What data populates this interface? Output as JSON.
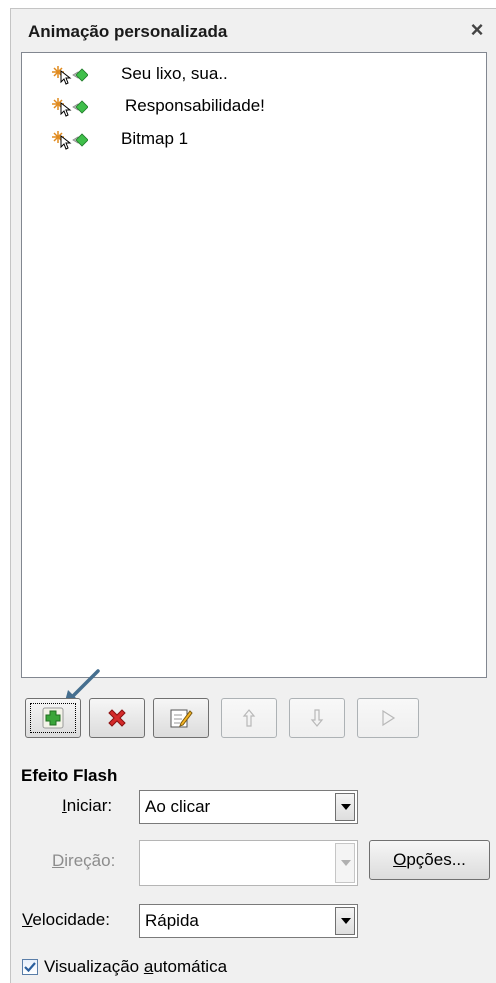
{
  "panel": {
    "title": "Animação personalizada",
    "close_glyph": "×"
  },
  "animation_list": [
    {
      "label": "Seu lixo, sua..",
      "icon": "flash-effect-icon"
    },
    {
      "label": "Responsabilidade!",
      "icon": "flash-effect-icon"
    },
    {
      "label": "Bitmap 1",
      "icon": "flash-effect-icon"
    }
  ],
  "toolbar": {
    "buttons": [
      {
        "name": "add-effect-button",
        "icon": "plus-icon",
        "enabled": true,
        "focused": true
      },
      {
        "name": "remove-effect-button",
        "icon": "delete-x-icon",
        "enabled": true
      },
      {
        "name": "edit-effect-button",
        "icon": "edit-pencil-icon",
        "enabled": true
      },
      {
        "name": "move-up-button",
        "icon": "arrow-up-icon",
        "enabled": false
      },
      {
        "name": "move-down-button",
        "icon": "arrow-down-icon",
        "enabled": false
      },
      {
        "name": "play-button",
        "icon": "play-icon",
        "enabled": false
      }
    ],
    "pointer_annotation": "arrow-pointer-icon"
  },
  "effect": {
    "heading": "Efeito Flash",
    "start": {
      "label_prefix": "",
      "label_mnemonic": "I",
      "label_rest": "niciar:",
      "value": "Ao clicar"
    },
    "direction": {
      "label_prefix": "",
      "label_mnemonic": "D",
      "label_rest": "ireção:",
      "value": ""
    },
    "speed": {
      "label_prefix": "",
      "label_mnemonic": "V",
      "label_rest": "elocidade:",
      "value": "Rápida"
    },
    "options_button": {
      "mnemonic": "O",
      "rest": "pções..."
    }
  },
  "auto_preview": {
    "prefix": "Visualização ",
    "mnemonic": "a",
    "rest": "utomática",
    "checked": true
  },
  "colors": {
    "plus_green": "#3aa53a",
    "delete_red": "#d42a2a",
    "checkbox_blue": "#2a5f9e",
    "annotation_arrow": "#466f8f"
  }
}
